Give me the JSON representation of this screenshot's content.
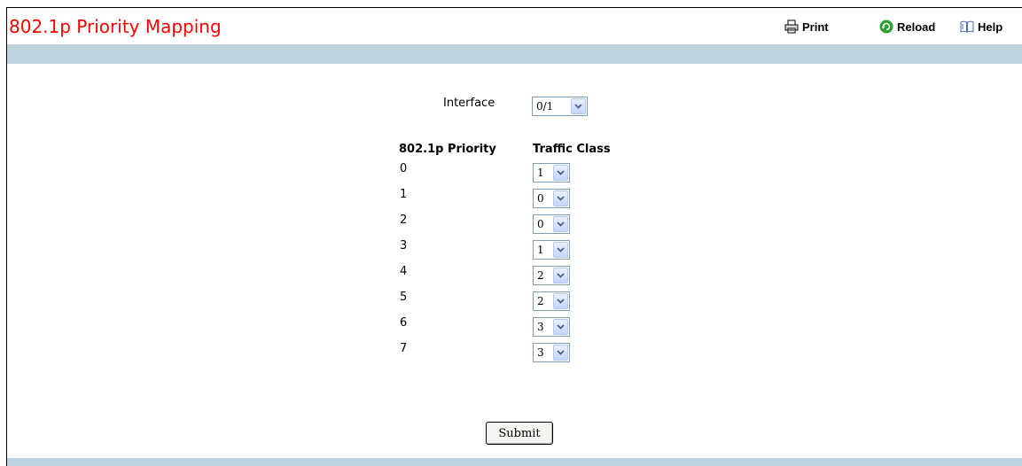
{
  "header": {
    "title": "802.1p Priority Mapping",
    "print_label": "Print",
    "reload_label": "Reload",
    "help_label": "Help"
  },
  "form": {
    "interface_label": "Interface",
    "interface_value": "0/1",
    "col_priority": "802.1p Priority",
    "col_traffic_class": "Traffic Class",
    "rows": [
      {
        "priority": "0",
        "traffic_class": "1"
      },
      {
        "priority": "1",
        "traffic_class": "0"
      },
      {
        "priority": "2",
        "traffic_class": "0"
      },
      {
        "priority": "3",
        "traffic_class": "1"
      },
      {
        "priority": "4",
        "traffic_class": "2"
      },
      {
        "priority": "5",
        "traffic_class": "2"
      },
      {
        "priority": "6",
        "traffic_class": "3"
      },
      {
        "priority": "7",
        "traffic_class": "3"
      }
    ],
    "submit_label": "Submit"
  },
  "colors": {
    "title": "#ff0000",
    "band": "#bfd3de",
    "reload_icon": "#2e9e2e"
  }
}
